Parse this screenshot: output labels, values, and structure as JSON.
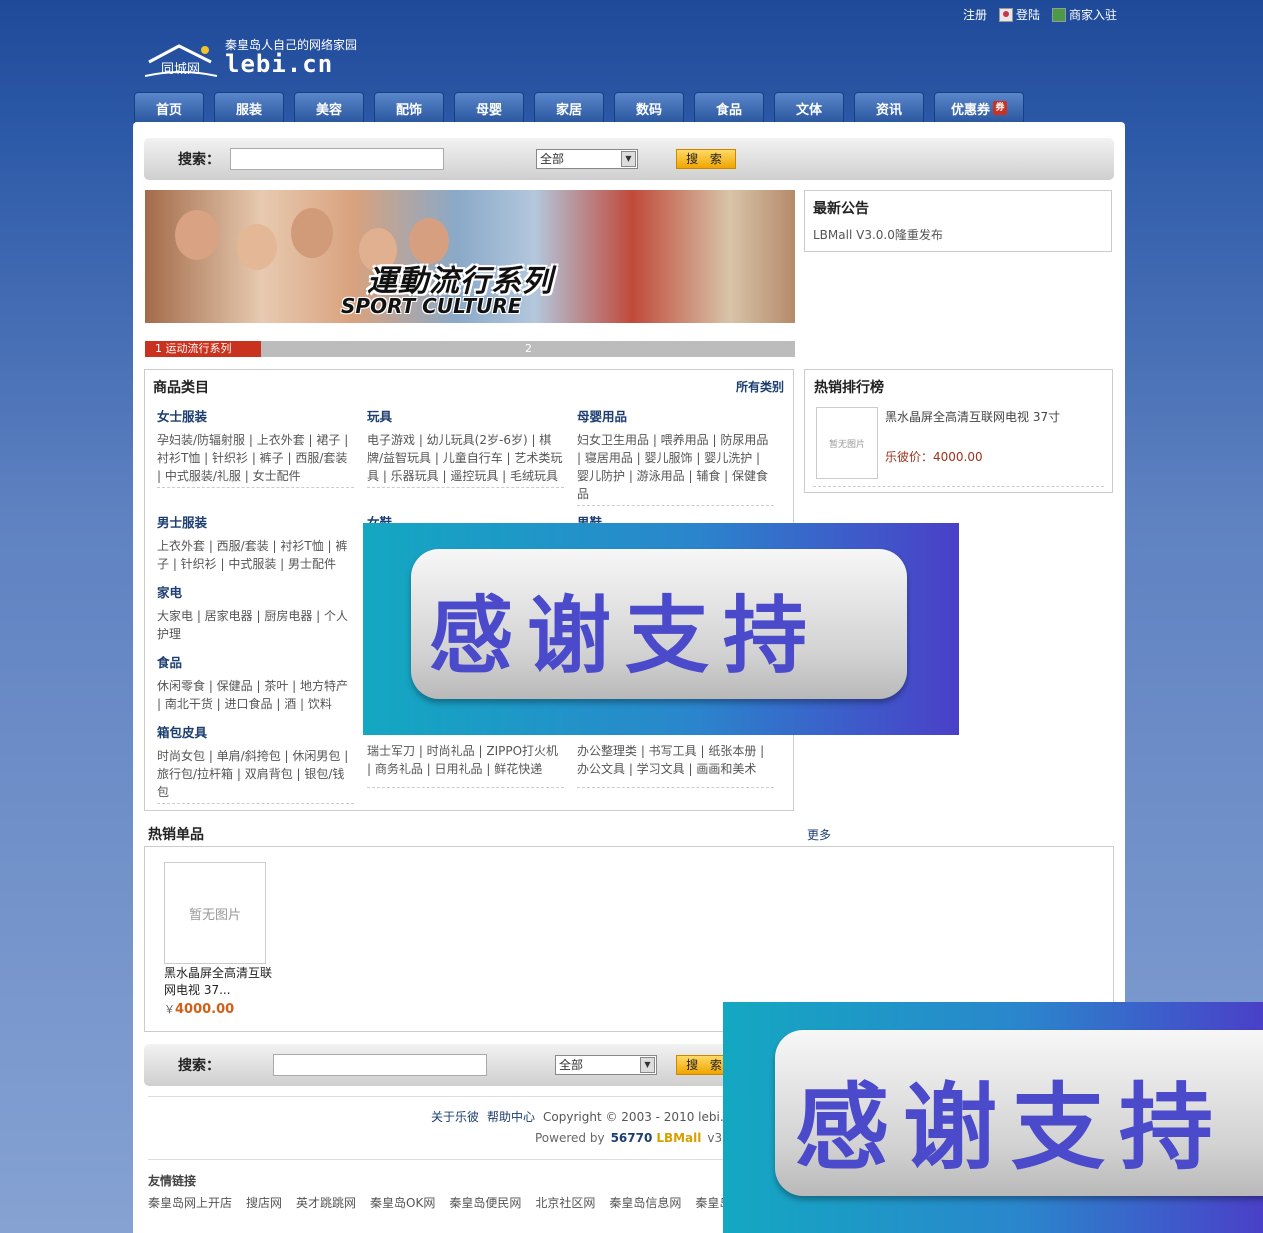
{
  "top_links": {
    "register": "注册",
    "login": "登陆",
    "merchant": "商家入驻"
  },
  "logo": {
    "badge": "同城网",
    "tagline": "秦皇岛人自己的网络家园",
    "domain": "lebi.cn"
  },
  "nav": [
    "首页",
    "服装",
    "美容",
    "配饰",
    "母婴",
    "家居",
    "数码",
    "食品",
    "文体",
    "资讯",
    "优惠券"
  ],
  "nav_badge": "券",
  "search": {
    "label": "搜索：",
    "select": "全部",
    "button": "搜 索"
  },
  "banner": {
    "title": "運動流行系列",
    "subtitle": "SPORT CULTURE",
    "slide1": "运动流行系列",
    "slide1_num": "1",
    "slide2_num": "2"
  },
  "notice": {
    "title": "最新公告",
    "item": "LBMall V3.0.0隆重发布"
  },
  "categories": {
    "title": "商品类目",
    "all": "所有类别",
    "col1": [
      {
        "name": "女士服装",
        "items": "孕妇装/防辐射服 | 上衣外套 | 裙子 | 衬衫T恤 | 针织衫 | 裤子 | 西服/套装 | 中式服装/礼服 | 女士配件"
      },
      {
        "name": "男士服装",
        "items": "上衣外套 | 西服/套装 | 衬衫T恤 | 裤子 | 针织衫 | 中式服装 | 男士配件"
      },
      {
        "name": "家电",
        "items": "大家电 | 居家电器 | 厨房电器 | 个人护理"
      },
      {
        "name": "食品",
        "items": "休闲零食 | 保健品 | 茶叶 | 地方特产 | 南北干货 | 进口食品 | 酒 | 饮料"
      },
      {
        "name": "箱包皮具",
        "items": "时尚女包 | 单肩/斜挎包 | 休闲男包 | 旅行包/拉杆箱 | 双肩背包 | 银包/钱包"
      }
    ],
    "col2": [
      {
        "name": "玩具",
        "items": "电子游戏 | 幼儿玩具(2岁-6岁) | 棋牌/益智玩具 | 儿童自行车 | 艺术类玩具 | 乐器玩具 | 遥控玩具 | 毛绒玩具"
      },
      {
        "name": "女鞋",
        "items": ""
      },
      {
        "name": "",
        "items": "瑞士军刀 | 时尚礼品 | ZIPPO打火机 | 商务礼品 | 日用礼品 | 鲜花快递"
      }
    ],
    "col3": [
      {
        "name": "母婴用品",
        "items": "妇女卫生用品 | 喂养用品 | 防尿用品 | 寝居用品 | 婴儿服饰 | 婴儿洗护 | 婴儿防护 | 游泳用品 | 辅食 | 保健食品"
      },
      {
        "name": "男鞋",
        "items": ""
      },
      {
        "name": "",
        "items": "办公整理类 | 书写工具 | 纸张本册 | 办公文具 | 学习文具 | 画画和美术"
      }
    ]
  },
  "hot_rank": {
    "title": "热销排行榜",
    "no_image": "暂无图片",
    "name": "黑水晶屏全高清互联网电视 37寸",
    "price_label": "乐彼价：",
    "price": "4000.00"
  },
  "hot_single": {
    "title": "热销单品",
    "more": "更多",
    "no_image": "暂无图片",
    "name": "黑水晶屏全高清互联网电视 37...",
    "currency": "￥",
    "price": "4000.00"
  },
  "footer": {
    "about": "关于乐彼",
    "help": "帮助中心",
    "copyright": "Copyright © 2003 - 2010 lebi.cn 版",
    "powered": "Powered by",
    "powered_a": "56770",
    "powered_b": "LBMall",
    "version": "v3.0.0"
  },
  "friends": {
    "title": "友情链接",
    "links": [
      "秦皇岛网上开店",
      "搜店网",
      "英才跳跳网",
      "秦皇岛OK网",
      "秦皇岛便民网",
      "北京社区网",
      "秦皇岛信息网",
      "秦皇岛"
    ]
  },
  "overlay_text": "感谢支持"
}
